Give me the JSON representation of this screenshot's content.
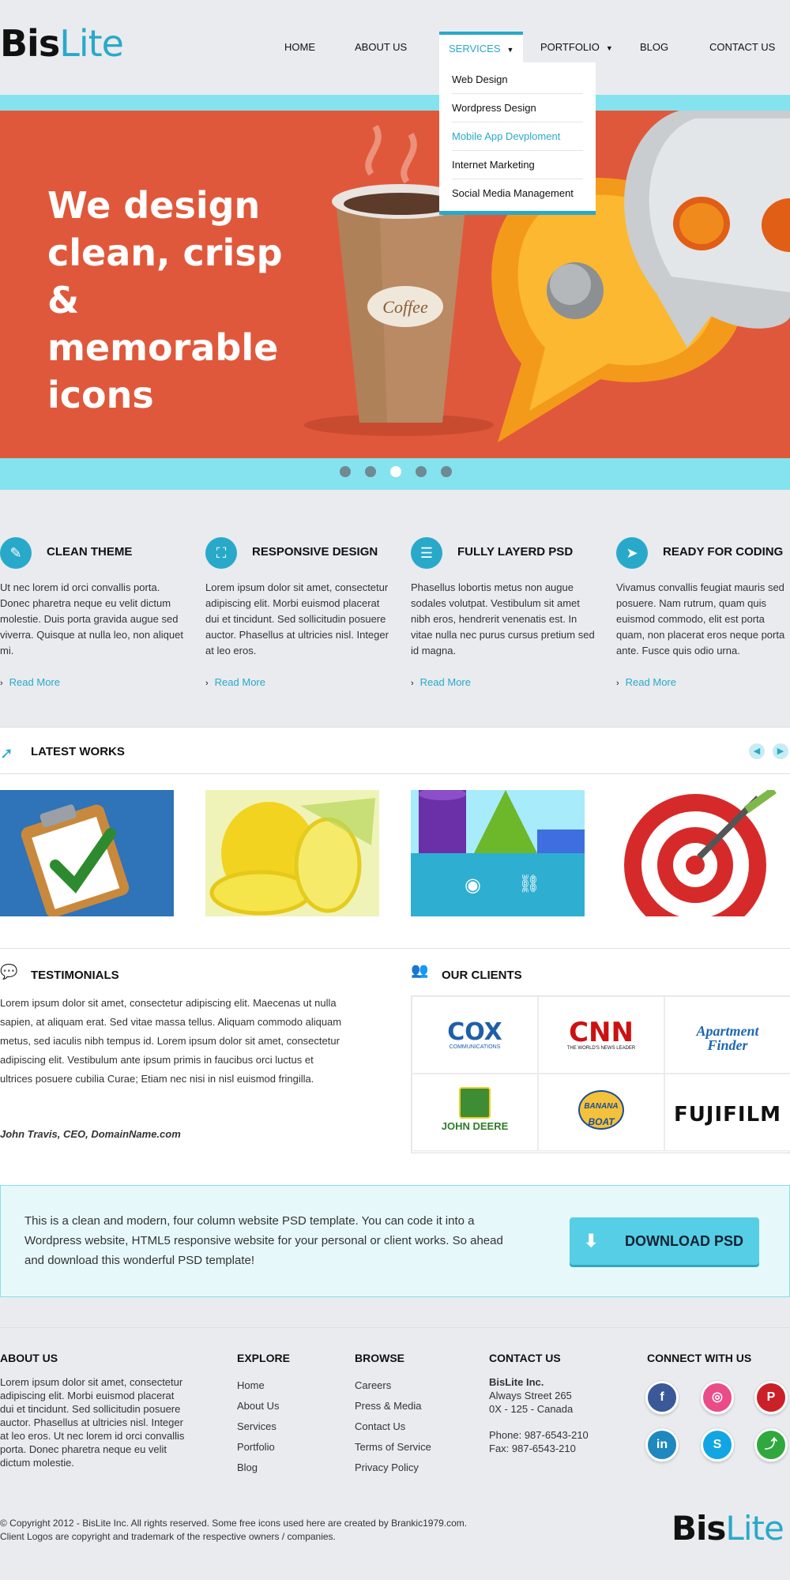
{
  "brand": {
    "part1": "Bis",
    "part2": "Lite"
  },
  "nav": {
    "items": [
      {
        "label": "HOME",
        "has_dropdown": false
      },
      {
        "label": "ABOUT US",
        "has_dropdown": false
      },
      {
        "label": "SERVICES",
        "has_dropdown": true,
        "active": true
      },
      {
        "label": "PORTFOLIO",
        "has_dropdown": true
      },
      {
        "label": "BLOG",
        "has_dropdown": false
      },
      {
        "label": "CONTACT US",
        "has_dropdown": false
      }
    ],
    "services_dropdown": [
      "Web Design",
      "Wordpress Design",
      "Mobile App Devploment",
      "Internet Marketing",
      "Social Media Management"
    ]
  },
  "hero": {
    "headline": "We design clean, crisp & memorable icons",
    "cup_label": "Coffee",
    "slide_count": 5,
    "active_slide": 3
  },
  "features": [
    {
      "icon": "pencil-icon",
      "title": "CLEAN THEME",
      "text": "Ut nec lorem id orci convallis porta. Donec pharetra neque eu velit dictum molestie. Duis porta gravida augue sed viverra. Quisque at nulla leo, non aliquet mi.",
      "more": "Read More"
    },
    {
      "icon": "resize-icon",
      "title": "RESPONSIVE DESIGN",
      "text": "Lorem ipsum dolor sit amet, consectetur adipiscing elit. Morbi euismod placerat dui et tincidunt. Sed sollicitudin posuere auctor. Phasellus at ultricies nisl. Integer at leo eros.",
      "more": "Read More"
    },
    {
      "icon": "layers-icon",
      "title": "FULLY LAYERD PSD",
      "text": " Phasellus lobortis metus non augue sodales volutpat. Vestibulum sit amet nibh eros, hendrerit venenatis est. In vitae nulla nec purus cursus pretium sed id magna.",
      "more": "Read More"
    },
    {
      "icon": "paper-plane-icon",
      "title": "READY FOR CODING",
      "text": "Vivamus convallis feugiat mauris sed posuere. Nam rutrum, quam quis euismod commodo, elit est porta quam, non placerat eros neque porta ante. Fusce quis odio urna.",
      "more": "Read More"
    }
  ],
  "works": {
    "title": "LATEST WORKS",
    "items": [
      "clipboard-checkmark",
      "lemons",
      "3d-shapes",
      "dart-target"
    ]
  },
  "testimonials": {
    "title": "TESTIMONIALS",
    "text": "Lorem ipsum dolor sit amet, consectetur adipiscing elit. Maecenas ut nulla sapien, at aliquam erat. Sed vitae massa tellus. Aliquam commodo aliquam metus, sed iaculis nibh tempus id. Lorem ipsum dolor sit amet, consectetur adipiscing elit. Vestibulum ante ipsum primis in faucibus orci luctus et ultrices posuere cubilia Curae; Etiam nec nisi in nisl euismod fringilla.",
    "author": "John Travis, CEO, DomainName.com"
  },
  "clients": {
    "title": "OUR CLIENTS",
    "logos": {
      "cox": "COX",
      "cox_sub": "COMMUNICATIONS",
      "cnn": "CNN",
      "cnn_sub": "THE WORLD'S NEWS LEADER",
      "apartment": "Apartment",
      "finder": "Finder",
      "deere": "JOHN DEERE",
      "banana1": "BANANA",
      "banana2": "BOAT",
      "fuji": "FUJIFILM"
    }
  },
  "cta": {
    "text": "This is a clean and modern, four column website PSD template. You can code it into a Wordpress website, HTML5 responsive website for your personal or client works. So ahead and download this wonderful PSD template!",
    "button": "DOWNLOAD PSD"
  },
  "footer": {
    "about": {
      "title": "ABOUT US",
      "text": "Lorem ipsum dolor sit amet, consectetur adipiscing elit. Morbi euismod placerat dui et tincidunt. Sed sollicitudin posuere auctor. Phasellus at ultricies nisl. Integer at leo eros. Ut nec lorem id orci convallis porta. Donec pharetra neque eu velit dictum molestie."
    },
    "explore": {
      "title": "EXPLORE",
      "links": [
        "Home",
        "About Us",
        "Services",
        "Portfolio",
        "Blog"
      ]
    },
    "browse": {
      "title": "BROWSE",
      "links": [
        "Careers",
        "Press & Media",
        "Contact Us",
        "Terms of Service",
        "Privacy Policy"
      ]
    },
    "contact": {
      "title": "CONTACT US",
      "company": "BisLite Inc.",
      "street": "Always Street 265",
      "city": "0X - 125 - Canada",
      "phone": "Phone: 987-6543-210",
      "fax": "Fax: 987-6543-210"
    },
    "connect": {
      "title": "CONNECT WITH US",
      "networks": [
        "facebook",
        "dribbble",
        "pinterest",
        "linkedin",
        "skype",
        "share"
      ]
    },
    "copyright1": "© Copyright 2012 - BisLite Inc. All rights reserved. Some free icons used here are created by Brankic1979.com.",
    "copyright2": "Client Logos are copyright and trademark of the respective owners / companies."
  },
  "colors": {
    "accent": "#29a9c9",
    "hero": "#e0583b",
    "band": "#85e3ef",
    "background": "#e9ebef"
  }
}
